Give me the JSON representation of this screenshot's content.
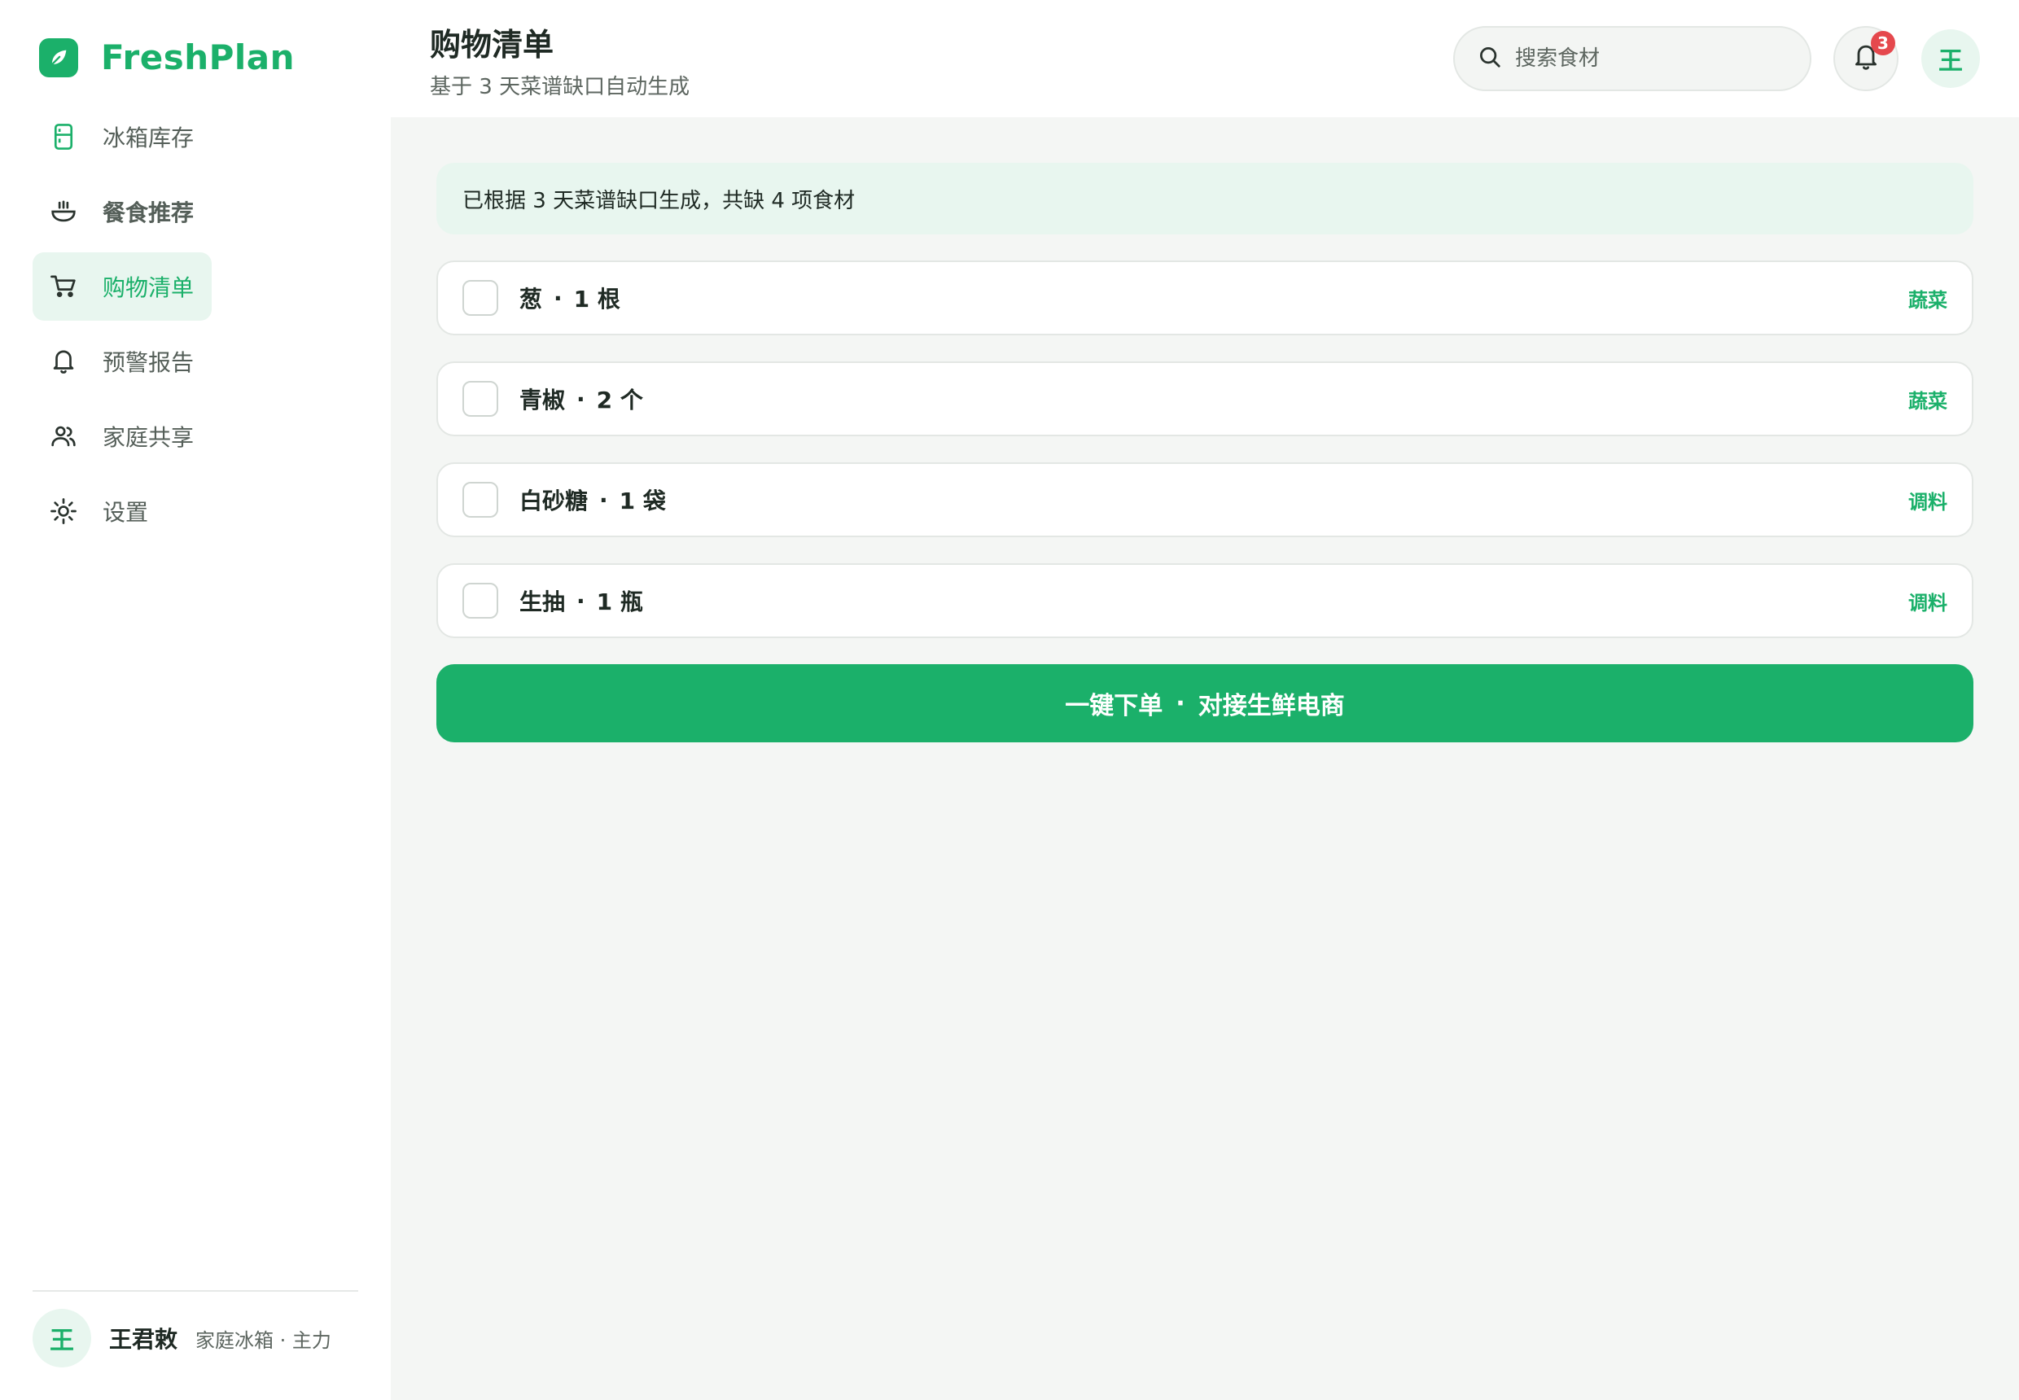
{
  "app": {
    "name": "FreshPlan"
  },
  "sidebar": {
    "items": [
      {
        "label": "冰箱库存",
        "icon": "fridge-icon",
        "active": false
      },
      {
        "label": "餐食推荐",
        "icon": "bowl-icon",
        "active": false
      },
      {
        "label": "购物清单",
        "icon": "cart-icon",
        "active": true
      },
      {
        "label": "预警报告",
        "icon": "bell-icon",
        "active": false
      },
      {
        "label": "家庭共享",
        "icon": "users-icon",
        "active": false
      },
      {
        "label": "设置",
        "icon": "gear-icon",
        "active": false
      }
    ],
    "user": {
      "avatar_text": "王",
      "name": "王君敕",
      "role": "家庭冰箱 · 主力"
    }
  },
  "header": {
    "title": "购物清单",
    "subtitle": "基于 3 天菜谱缺口自动生成",
    "search_placeholder": "搜索食材",
    "notification_count": "3",
    "avatar_text": "王"
  },
  "main": {
    "notice": "已根据 3 天菜谱缺口生成，共缺 4 项食材",
    "separator": "·",
    "items": [
      {
        "name": "葱",
        "qty": "1 根",
        "category": "蔬菜",
        "checked": false
      },
      {
        "name": "青椒",
        "qty": "2 个",
        "category": "蔬菜",
        "checked": false
      },
      {
        "name": "白砂糖",
        "qty": "1 袋",
        "category": "调料",
        "checked": false
      },
      {
        "name": "生抽",
        "qty": "1 瓶",
        "category": "调料",
        "checked": false
      }
    ],
    "order_button": {
      "label": "一键下单",
      "separator": "·",
      "sublabel": "对接生鲜电商"
    }
  },
  "colors": {
    "accent": "#1bb06a",
    "accent_soft": "#e8f6ef",
    "badge": "#e5484d",
    "main_bg": "#f4f6f4"
  }
}
